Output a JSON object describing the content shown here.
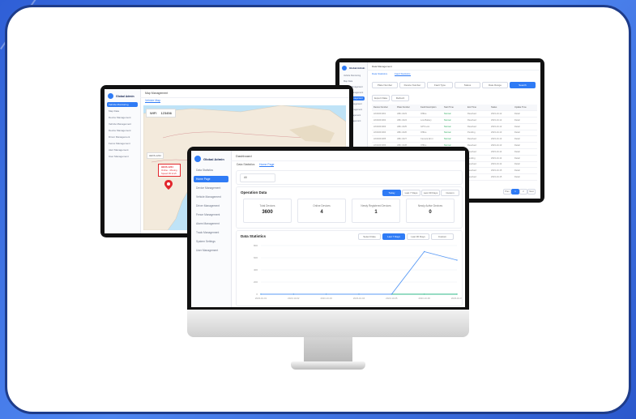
{
  "colors": {
    "background": "#3b6fe0",
    "card_border": "#1e3c8a",
    "accent": "#2f7bf5",
    "map_sea": "#bfe3f7",
    "map_land": "#f3eadc",
    "marker": "#e2262c"
  },
  "left_monitor": {
    "app_name": "Global Admin",
    "top_title": "Map Management",
    "tab_label": "Vehicle Map",
    "nav": [
      "Vehicle Monitoring",
      "Map Data",
      "Device Management",
      "Vehicle Management",
      "Device Management",
      "Driver Management",
      "Fence Management",
      "Alert Management",
      "User Management"
    ],
    "map_popup": {
      "label": "WIFI",
      "value": "123456"
    },
    "marker_popup": {
      "title": "HEXS-1234",
      "line2": "Online - Moving",
      "line3": "Speed 45 km/h"
    }
  },
  "right_monitor": {
    "app_name": "Global Admin",
    "top_title": "Data Management",
    "tabs": [
      "Data Statistics",
      "Fault Statistics"
    ],
    "filters": [
      "Plate Number",
      "Device Number",
      "Fault Type",
      "Status",
      "Date Range",
      "Search"
    ],
    "toolbar": [
      "Export Data",
      "Refresh"
    ],
    "columns": [
      "Device Number",
      "Plate Number",
      "Fault Description",
      "Start Time",
      "End Time",
      "Status",
      "Update Time"
    ],
    "rows": [
      [
        "HX20231001",
        "ABC-1023",
        "Offline",
        "Normal",
        "Resolved",
        "2023-10-12",
        "Detail"
      ],
      [
        "HX20231002",
        "ABC-1024",
        "Low Battery",
        "Normal",
        "Resolved",
        "2023-10-12",
        "Detail"
      ],
      [
        "HX20231003",
        "ABC-1025",
        "GPS Lost",
        "Normal",
        "Resolved",
        "2023-10-12",
        "Detail"
      ],
      [
        "HX20231004",
        "ABC-1026",
        "Offline",
        "Normal",
        "Pending",
        "2023-10-13",
        "Detail"
      ],
      [
        "HX20231005",
        "ABC-1027",
        "Camera Error",
        "Normal",
        "Resolved",
        "2023-10-13",
        "Detail"
      ],
      [
        "HX20231006",
        "ABC-1028",
        "Offline",
        "Normal",
        "Resolved",
        "2023-10-13",
        "Detail"
      ],
      [
        "HX20231007",
        "ABC-1029",
        "Overspeed",
        "Normal",
        "Resolved",
        "2023-10-14",
        "Detail"
      ],
      [
        "HX20231008",
        "ABC-1030",
        "Offline",
        "Normal",
        "Pending",
        "2023-10-14",
        "Detail"
      ],
      [
        "HX20231009",
        "ABC-1031",
        "Low Battery",
        "Normal",
        "Resolved",
        "2023-10-14",
        "Detail"
      ],
      [
        "HX20231010",
        "ABC-1032",
        "Offline",
        "Normal",
        "Resolved",
        "2023-10-15",
        "Detail"
      ],
      [
        "HX20231011",
        "ABC-1033",
        "GPS Lost",
        "Normal",
        "Resolved",
        "2023-10-15",
        "Detail"
      ]
    ],
    "pagination": [
      "Prev",
      "1",
      "2",
      "Next"
    ]
  },
  "center_monitor": {
    "app_name": "Global Admin",
    "top_title": "Dashboard",
    "tabs": [
      "Data Statistics",
      "Home Page"
    ],
    "nav": [
      "Data Statistics",
      "Home Page",
      "Device Management",
      "Vehicle Management",
      "Driver Management",
      "Fence Management",
      "Alarm Management",
      "Track Management",
      "System Settings",
      "User Management"
    ],
    "search_value": "All",
    "overview_title": "Operation Data",
    "range_buttons": [
      "Today",
      "Last 7 Days",
      "Last 30 Days",
      "Custom"
    ],
    "stats": [
      {
        "label": "Total Devices",
        "value": "3600"
      },
      {
        "label": "Online Devices",
        "value": "4"
      },
      {
        "label": "Newly Registered Devices",
        "value": "1"
      },
      {
        "label": "Newly Active Devices",
        "value": "0"
      }
    ],
    "chart_title": "Data Statistics",
    "chart_buttons": [
      "Select Date",
      "Last 7 Days",
      "Last 30 Days",
      "Custom"
    ],
    "y_ticks": [
      "800",
      "600",
      "400",
      "200",
      "0"
    ],
    "x_ticks": [
      "2023-10-01",
      "2023-10-02",
      "2023-10-03",
      "2023-10-04",
      "2023-10-05",
      "2023-10-06",
      "2023-10-07"
    ]
  },
  "chart_data": {
    "type": "line",
    "title": "Data Statistics",
    "x": [
      "2023-10-01",
      "2023-10-02",
      "2023-10-03",
      "2023-10-04",
      "2023-10-05",
      "2023-10-06",
      "2023-10-07"
    ],
    "series": [
      {
        "values": [
          0,
          0,
          0,
          0,
          0,
          0,
          0
        ]
      },
      {
        "values": [
          0,
          0,
          0,
          0,
          0,
          700,
          560
        ]
      }
    ],
    "ylim": [
      0,
      800
    ],
    "grid": true
  }
}
